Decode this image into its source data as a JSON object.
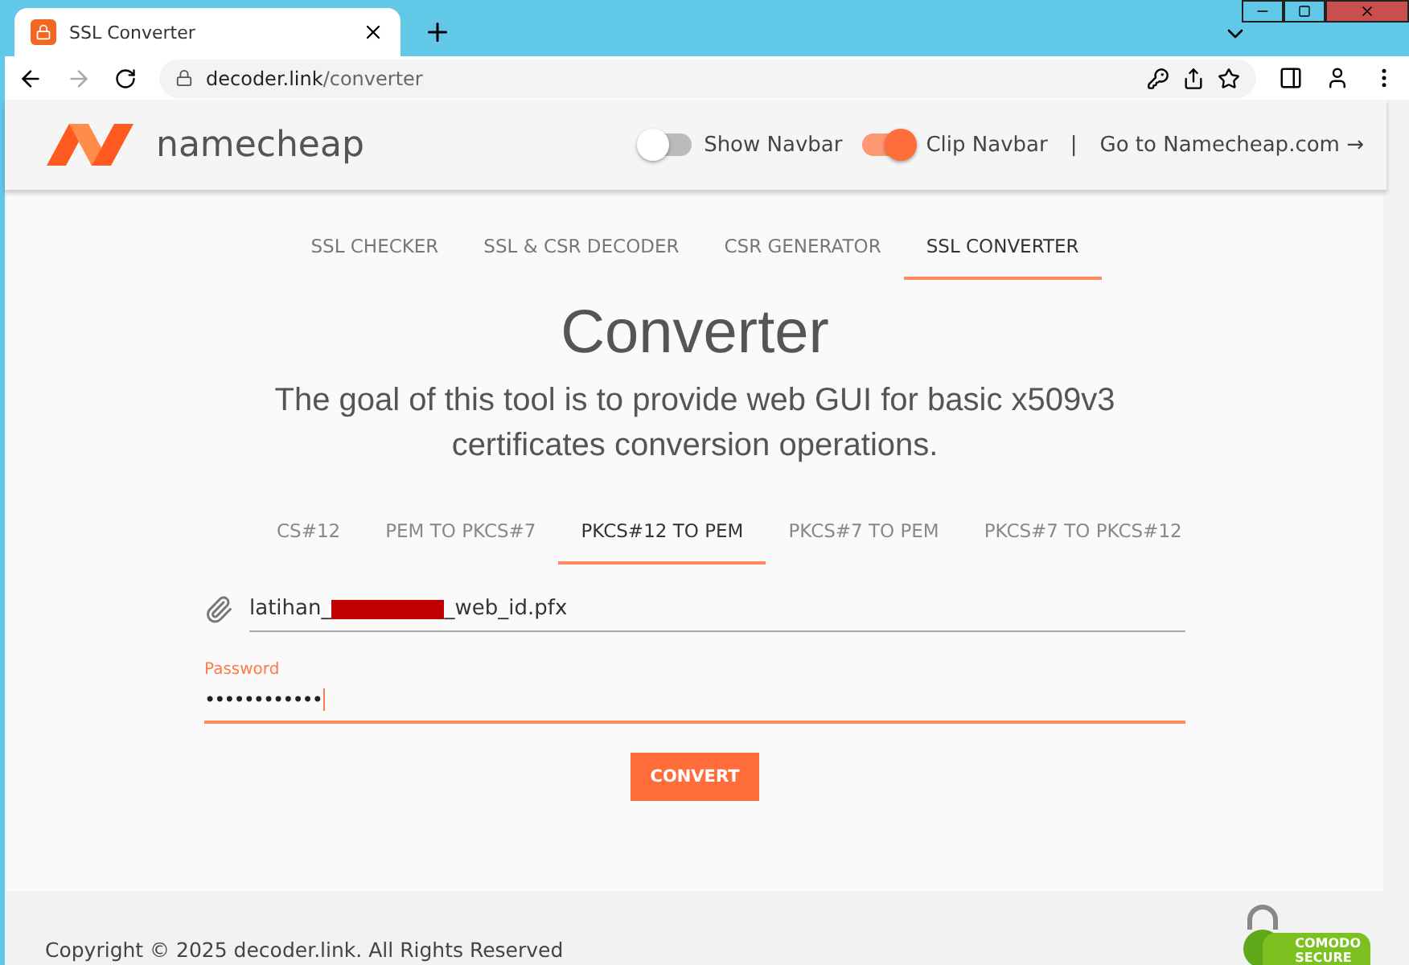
{
  "browser": {
    "tab_title": "SSL Converter",
    "url_host": "decoder.link",
    "url_path": "/converter"
  },
  "header": {
    "logo_text": "namecheap",
    "toggles": [
      {
        "label": "Show Navbar",
        "on": false
      },
      {
        "label": "Clip Navbar",
        "on": true
      }
    ],
    "separator": "|",
    "link": "Go to Namecheap.com →"
  },
  "nav": [
    {
      "label": "SSL CHECKER",
      "selected": false
    },
    {
      "label": "SSL & CSR DECODER",
      "selected": false
    },
    {
      "label": "CSR GENERATOR",
      "selected": false
    },
    {
      "label": "SSL CONVERTER",
      "selected": true
    }
  ],
  "title": "Converter",
  "subtitle": "The goal of this tool is to provide web GUI for basic x509v3 certificates conversion operations.",
  "converter_tabs": [
    {
      "label": "CS#12",
      "selected": false
    },
    {
      "label": "PEM TO PKCS#7",
      "selected": false
    },
    {
      "label": "PKCS#12 TO PEM",
      "selected": true
    },
    {
      "label": "PKCS#7 TO PEM",
      "selected": false
    },
    {
      "label": "PKCS#7 TO PKCS#12",
      "selected": false
    }
  ],
  "file_field": {
    "value_start": "latihan_",
    "redacted": true,
    "value_end": "_web_id.pfx"
  },
  "password_field": {
    "label": "Password",
    "value": "••••••••••••",
    "focused": true
  },
  "convert_button": "CONVERT",
  "footer": {
    "copyright": "Copyright © 2025 decoder.link. All Rights Reserved",
    "badge_text": "COMODO",
    "badge_text_2": "SECURE"
  }
}
